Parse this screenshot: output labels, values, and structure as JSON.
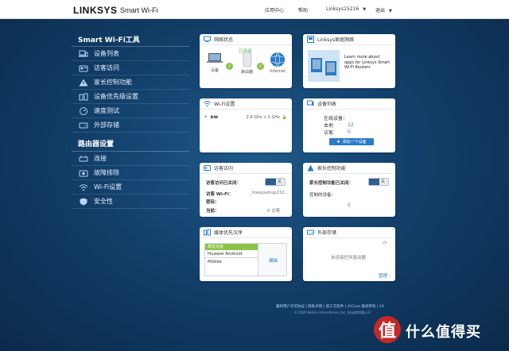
{
  "header": {
    "brand": "LINKSYS",
    "product": "Smart Wi-Fi",
    "nav": {
      "app_center": "应用中心",
      "help": "帮助",
      "router_name": "Linksys15216",
      "logout": "退出"
    }
  },
  "sidebar": {
    "smart_title": "Smart Wi-Fi工具",
    "smart_items": [
      {
        "label": "设备列表",
        "icon": "device-list-icon"
      },
      {
        "label": "访客访问",
        "icon": "guest-access-icon"
      },
      {
        "label": "家长控制功能",
        "icon": "parental-controls-icon"
      },
      {
        "label": "设备优先级设置",
        "icon": "priority-icon"
      },
      {
        "label": "速度测试",
        "icon": "speed-test-icon"
      },
      {
        "label": "外部存储",
        "icon": "external-storage-icon"
      }
    ],
    "router_title": "路由器设置",
    "router_items": [
      {
        "label": "连接",
        "icon": "connectivity-icon"
      },
      {
        "label": "故障排除",
        "icon": "troubleshooting-icon"
      },
      {
        "label": "Wi-Fi设置",
        "icon": "wifi-icon"
      },
      {
        "label": "安全性",
        "icon": "security-icon"
      }
    ]
  },
  "cards": {
    "network": {
      "title": "网络状态",
      "status": "已连接",
      "labels": {
        "devices": "设备",
        "router": "路由器",
        "internet": "Internet"
      }
    },
    "promo": {
      "title": "Linksys家庭网络",
      "text": "Learn more about apps for Linksys Smart Wi-Fi Routers"
    },
    "wifi": {
      "title": "Wi-Fi设置",
      "ssid": "ew",
      "bands": "2.4 GHz + 5 GHz"
    },
    "devices": {
      "title": "设备列表",
      "online_label": "在线设备：",
      "local_label": "本地",
      "local_value": "12",
      "guest_label": "访客",
      "guest_value": "0",
      "add_button": "添加一个设备"
    },
    "guest": {
      "title": "访客访问",
      "toggle_label": "访客访问已关闭：",
      "toggle_state": "关",
      "wifi_label": "访客 Wi-Fi：",
      "wifi_value": "_Vwapsetup232...",
      "password_label": "密码：",
      "password_value": "",
      "current_label": "当前：",
      "current_value": "0 访客"
    },
    "parental": {
      "title": "家长控制功能",
      "toggle_label": "家长控制功能已关闭：",
      "toggle_state": "关",
      "controlled_label": "控制的设备：",
      "none": "无"
    },
    "media": {
      "title": "媒体优先次序",
      "priority_header": "高优先级",
      "device": "Huawei Android Mobile",
      "edit": "编辑"
    },
    "storage": {
      "title": "外部存储",
      "status": "未连接任何驱动器",
      "manage": "管理"
    }
  },
  "footer": {
    "links": "最终用户许可协议 | 隐私声明 | 第三方软件 | ©Cisco 版权所有 | CA",
    "copyright": "© 2020 Belkin International, Inc. 和/或其附属公司"
  },
  "watermark": {
    "logo_char": "值",
    "text": "什么值得买"
  },
  "colors": {
    "accent": "#2a7bc8",
    "success": "#8bc34a",
    "brand_bg": "#123f6a"
  }
}
